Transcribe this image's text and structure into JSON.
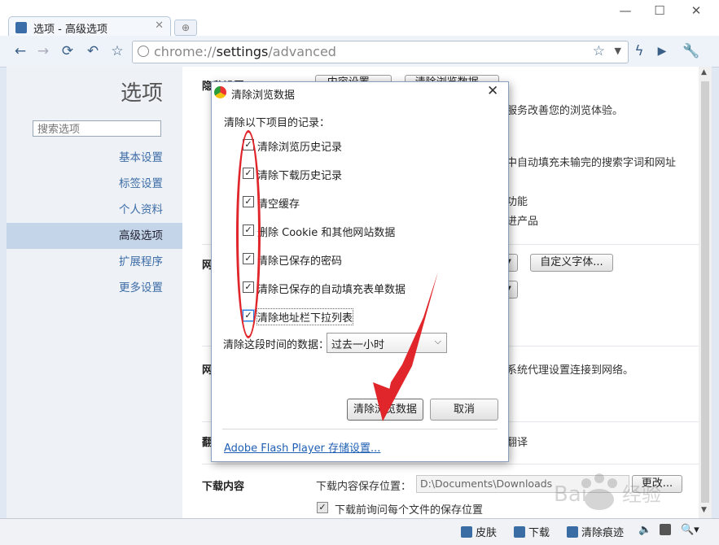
{
  "browser": {
    "tab_title": "选项 - 高级选项",
    "url_prefix": "chrome://",
    "url_main": "settings",
    "url_suffix": "/advanced"
  },
  "sidebar": {
    "title": "选项",
    "search_placeholder": "搜索选项",
    "items": [
      {
        "label": "基本设置"
      },
      {
        "label": "标签设置"
      },
      {
        "label": "个人资料"
      },
      {
        "label": "高级选项",
        "active": true
      },
      {
        "label": "扩展程序"
      },
      {
        "label": "更多设置"
      }
    ]
  },
  "content": {
    "privacy_title": "隐私设置",
    "content_settings_btn": "内容设置...",
    "clear_data_btn": "清除浏览数据...",
    "line1": "服务改善您的浏览体验。",
    "line2": "中自动填充未输完的搜索字词和网址",
    "line3": "功能",
    "line4": "进产品",
    "web_title_a": "网",
    "custom_font_btn": "自定义字体...",
    "web_title_b": "网",
    "proxy_text": "系统代理设置连接到网络。",
    "translate_a": "翻",
    "translate_b": "翻译",
    "download_title": "下载内容",
    "download_location_label": "下载内容保存位置：",
    "download_path": "D:\\Documents\\Downloads",
    "change_btn": "更改...",
    "ask_each_label": "下载前询问每个文件的保存位置"
  },
  "dialog": {
    "title": "清除浏览数据",
    "heading": "清除以下项目的记录：",
    "options": [
      {
        "label": "清除浏览历史记录",
        "checked": true
      },
      {
        "label": "清除下载历史记录",
        "checked": true
      },
      {
        "label": "清空缓存",
        "checked": true
      },
      {
        "label": "删除 Cookie 和其他网站数据",
        "checked": true
      },
      {
        "label": "清除已保存的密码",
        "checked": true
      },
      {
        "label": "清除已保存的自动填充表单数据",
        "checked": true
      },
      {
        "label": "清除地址栏下拉列表",
        "checked": true
      }
    ],
    "time_label": "清除这段时间的数据：",
    "time_value": "过去一小时",
    "confirm_btn": "清除浏览数据",
    "cancel_btn": "取消",
    "flash_link": "Adobe Flash Player 存储设置..."
  },
  "statusbar": {
    "skin": "皮肤",
    "download": "下载",
    "clear_traces": "清除痕迹"
  },
  "colors": {
    "accent": "#3d6ca6",
    "annotation_red": "#e0262b",
    "sidebar_active": "#c4d5ea"
  }
}
